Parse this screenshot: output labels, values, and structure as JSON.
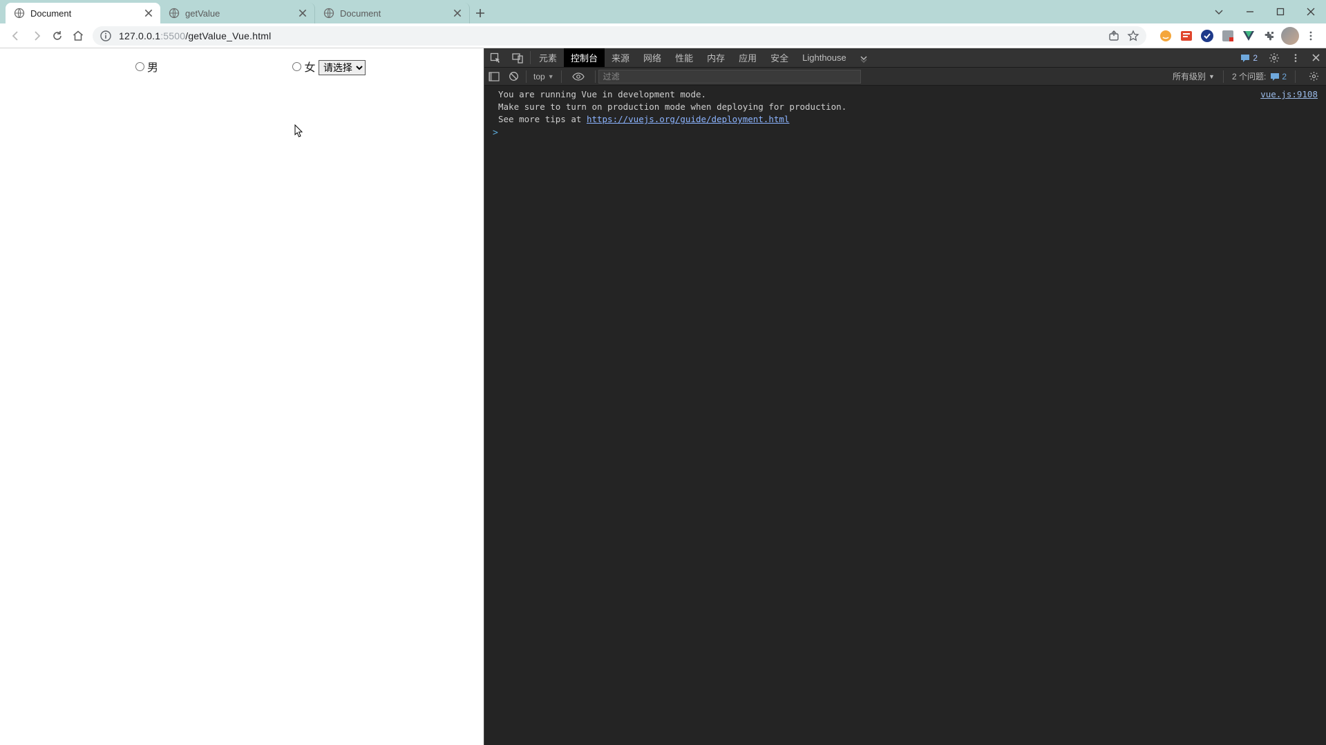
{
  "tabs": [
    {
      "title": "Document",
      "active": true
    },
    {
      "title": "getValue",
      "active": false
    },
    {
      "title": "Document",
      "active": false
    }
  ],
  "address": {
    "host": "127.0.0.1",
    "port": ":5500",
    "path": "/getValue_Vue.html"
  },
  "page": {
    "radio_male": "男",
    "radio_female": "女",
    "select_placeholder": "请选择"
  },
  "devtools": {
    "tabs": {
      "elements": "元素",
      "console": "控制台",
      "sources": "来源",
      "network": "网络",
      "performance": "性能",
      "memory": "内存",
      "application": "应用",
      "security": "安全",
      "lighthouse": "Lighthouse"
    },
    "msg_count": "2",
    "ctrl": {
      "context": "top",
      "filter_placeholder": "过滤",
      "levels": "所有级别",
      "issues_label": "2 个问题:",
      "issues_count": "2"
    },
    "log": {
      "line1": "You are running Vue in development mode.",
      "line2": "Make sure to turn on production mode when deploying for production.",
      "line3_prefix": "See more tips at ",
      "line3_link": "https://vuejs.org/guide/deployment.html",
      "src": "vue.js:9108"
    },
    "prompt": ">"
  }
}
